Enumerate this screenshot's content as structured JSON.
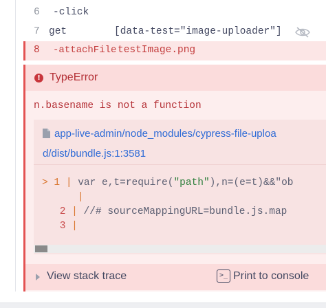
{
  "command_log": [
    {
      "number": "6",
      "name": "-click",
      "message": ""
    },
    {
      "number": "7",
      "name": "get",
      "message": "[data-test=\"image-uploader\"]"
    },
    {
      "number": "8",
      "name": "-attachFile",
      "message": "testImage.png"
    }
  ],
  "error": {
    "title": "TypeError",
    "icon": "error-circle-icon",
    "message": "n.basename is not a function",
    "file_path_line1": "app-live-admin/node_modules/cypress-file-uploa",
    "file_path_line2": "d/dist/bundle.js:1:3581",
    "code_frame": [
      {
        "arrow": ">",
        "line": "1",
        "text_pre": "var e,t=require(",
        "text_str": "\"path\"",
        "text_post": "),n=(e=t)&&\"ob"
      },
      {
        "arrow": "",
        "line": "",
        "text_pre": "",
        "text_str": "",
        "text_post": ""
      },
      {
        "arrow": "",
        "line": "2",
        "text_pre": "//# sourceMappingURL=bundle.js.map",
        "text_str": "",
        "text_post": ""
      },
      {
        "arrow": "",
        "line": "3",
        "text_pre": "",
        "text_str": "",
        "text_post": ""
      }
    ],
    "view_stack_trace": "View stack trace",
    "print_to_console": "Print to console",
    "console_icon_glyph": ">_"
  },
  "colors": {
    "error_red": "#b42f35",
    "link_blue": "#2e6bd6",
    "accent_orange": "#d9762f"
  }
}
